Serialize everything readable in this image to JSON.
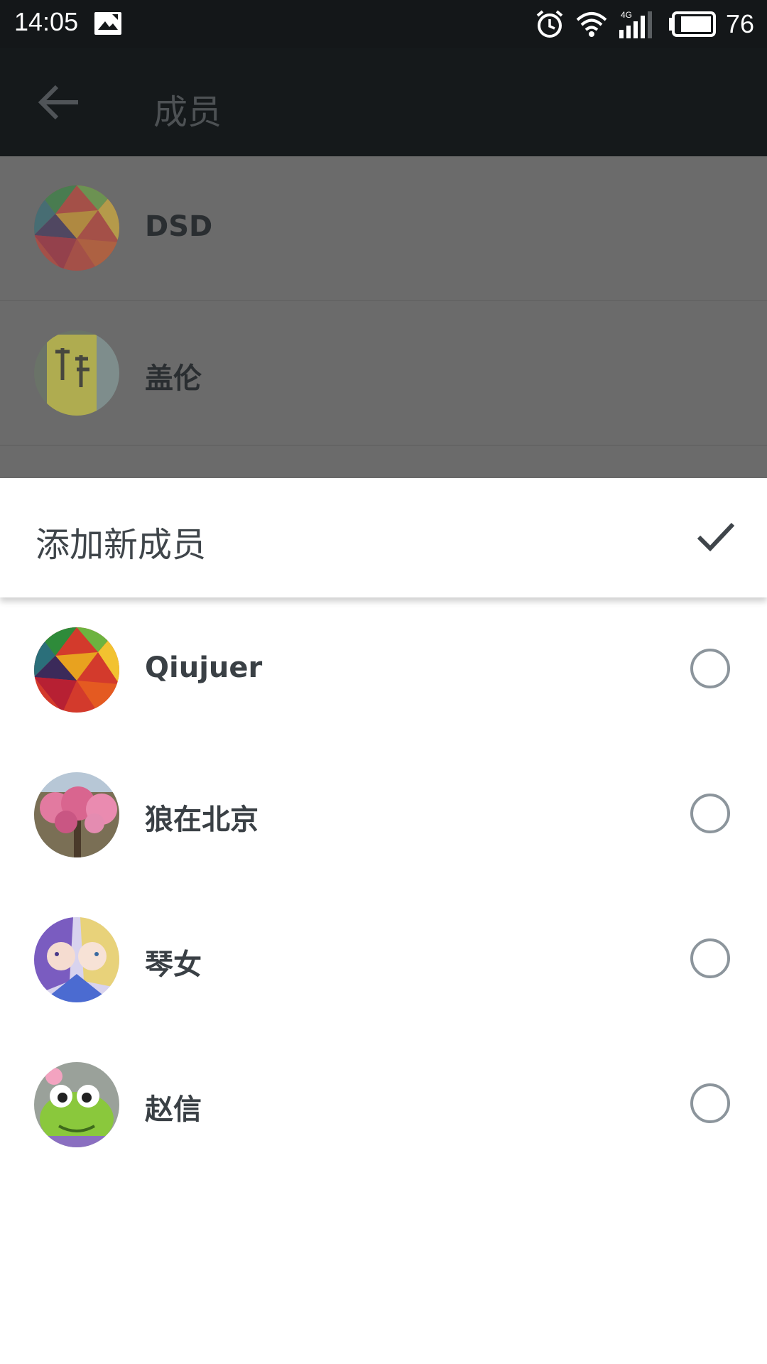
{
  "status_bar": {
    "time": "14:05",
    "battery": "76",
    "icons": [
      "gallery-icon",
      "alarm-icon",
      "wifi-icon",
      "signal-4g-icon",
      "battery-icon"
    ]
  },
  "app_bar": {
    "title": "成员",
    "back_icon": "arrow-left-icon"
  },
  "members": [
    {
      "name": "DSD",
      "avatar": "polygon-rainbow-avatar"
    },
    {
      "name": "盖伦",
      "avatar": "yellow-can-avatar"
    }
  ],
  "sheet": {
    "title": "添加新成员",
    "confirm_icon": "check-icon"
  },
  "candidates": [
    {
      "name": "Qiujuer",
      "avatar": "polygon-rainbow-avatar",
      "selected": false
    },
    {
      "name": "狼在北京",
      "avatar": "blossom-tree-avatar",
      "selected": false
    },
    {
      "name": "琴女",
      "avatar": "anime-girls-avatar",
      "selected": false
    },
    {
      "name": "赵信",
      "avatar": "green-frog-avatar",
      "selected": false
    }
  ],
  "colors": {
    "status_bar_bg": "#141719",
    "app_bar_bg": "#15191b",
    "dim_overlay": "#6b6b6b",
    "radio_border": "#8c959c",
    "text_primary": "#3a4045"
  }
}
